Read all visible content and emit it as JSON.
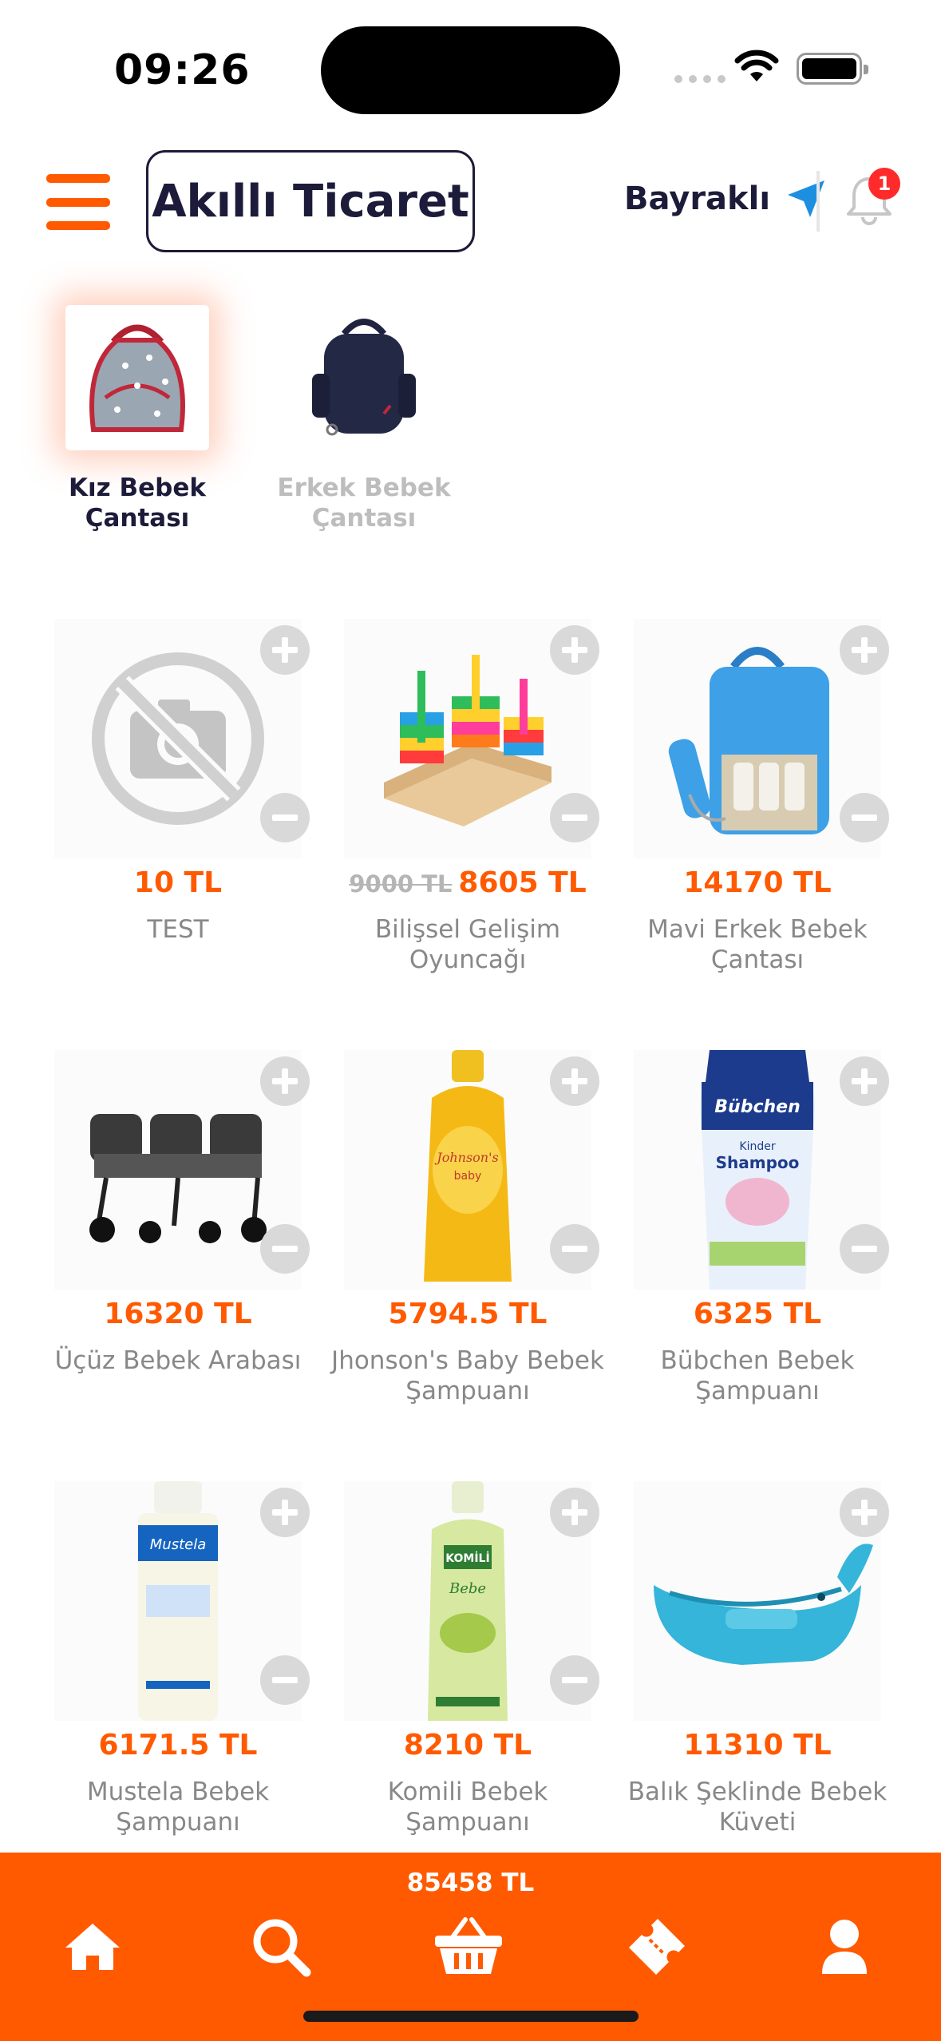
{
  "status_bar": {
    "time": "09:26"
  },
  "header": {
    "brand": "Akıllı Ticaret",
    "location": "Bayraklı",
    "notification_count": "1"
  },
  "categories": [
    {
      "label_line1": "Kız Bebek",
      "label_line2": "Çantası",
      "active": true
    },
    {
      "label_line1": "Erkek Bebek",
      "label_line2": "Çantası",
      "active": false
    }
  ],
  "products": [
    {
      "old_price": "",
      "price": "10 TL",
      "name_line1": "TEST",
      "name_line2": "",
      "image": "no-photo-icon"
    },
    {
      "old_price": "9000 TL",
      "price": "8605 TL",
      "name_line1": "Bilişsel Gelişim",
      "name_line2": "Oyuncağı",
      "image": "shape-sorter-toy"
    },
    {
      "old_price": "",
      "price": "14170 TL",
      "name_line1": "Mavi Erkek Bebek",
      "name_line2": "Çantası",
      "image": "blue-diaper-bag"
    },
    {
      "old_price": "",
      "price": "16320 TL",
      "name_line1": "Üçüz Bebek Arabası",
      "name_line2": "",
      "image": "triple-stroller"
    },
    {
      "old_price": "",
      "price": "5794.5 TL",
      "name_line1": "Jhonson's Baby Bebek",
      "name_line2": "Şampuanı",
      "image": "johnsons-shampoo"
    },
    {
      "old_price": "",
      "price": "6325 TL",
      "name_line1": "Bübchen Bebek",
      "name_line2": "Şampuanı",
      "image": "bubchen-shampoo"
    },
    {
      "old_price": "",
      "price": "6171.5 TL",
      "name_line1": "Mustela Bebek",
      "name_line2": "Şampuanı",
      "image": "mustela-shampoo"
    },
    {
      "old_price": "",
      "price": "8210 TL",
      "name_line1": "Komili Bebek",
      "name_line2": "Şampuanı",
      "image": "komili-shampoo"
    },
    {
      "old_price": "",
      "price": "11310 TL",
      "name_line1": "Balık Şeklinde Bebek",
      "name_line2": "Küveti",
      "image": "whale-bathtub"
    }
  ],
  "bottom_bar": {
    "cart_total": "85458 TL",
    "nav": [
      "home-icon",
      "search-icon",
      "basket-icon",
      "ticket-icon",
      "user-icon"
    ]
  },
  "colors": {
    "accent": "#ff5a00",
    "brand_dark": "#1c1b3a",
    "location_arrow": "#1e8fe0"
  },
  "product_image_labels": {
    "johnsons": "Johnson's",
    "johnsons_sub": "baby",
    "bubchen": "Bübchen",
    "bubchen_sub": "Kinder",
    "bubchen_name": "Shampoo",
    "mustela": "Mustela",
    "komili": "KOMİLİ",
    "komili_sub": "Bebe"
  }
}
